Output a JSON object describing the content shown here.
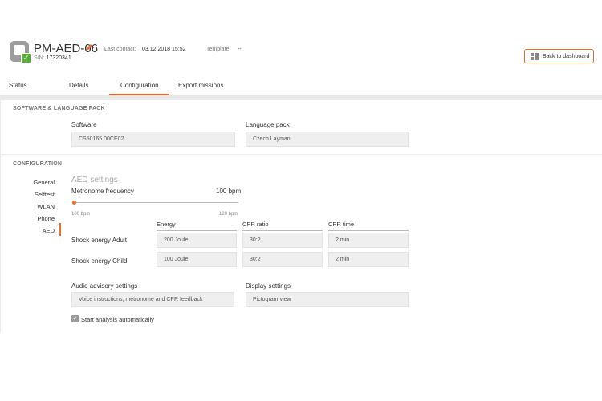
{
  "header": {
    "device_name": "PM-AED-06",
    "sn_label": "S/N:",
    "sn_value": "17320341",
    "last_contact_label": "Last contact:",
    "last_contact_value": "03.12.2018 15:52",
    "template_label": "Template:",
    "template_value": "--",
    "back_button_label": "Back to dashboard",
    "status_icon": "check-icon",
    "accent_color": "#ec6b2d",
    "status_color": "#5aae3a"
  },
  "tabs": [
    {
      "label": "Status"
    },
    {
      "label": "Details"
    },
    {
      "label": "Configuration",
      "active": true
    },
    {
      "label": "Export missions"
    }
  ],
  "software_section": {
    "title": "SOFTWARE & LANGUAGE PACK",
    "software_label": "Software",
    "software_value": "CS50165 00CE02",
    "language_label": "Language pack",
    "language_value": "Czech Layman"
  },
  "configuration_section": {
    "title": "CONFIGURATION",
    "nav": [
      {
        "label": "General"
      },
      {
        "label": "Selftest"
      },
      {
        "label": "WLAN"
      },
      {
        "label": "Phone"
      },
      {
        "label": "AED",
        "active": true
      }
    ],
    "aed_title": "AED settings",
    "metronome_label": "Metronome frequency",
    "metronome_value": "100 bpm",
    "slider_min_label": "100 bpm",
    "slider_max_label": "120 bpm",
    "slider_fraction": 0.0,
    "columns": [
      "Energy",
      "CPR ratio",
      "CPR time"
    ],
    "rows": [
      {
        "label": "Shock energy Adult",
        "energy": "200 Joule",
        "cpr_ratio": "30:2",
        "cpr_time": "2 min"
      },
      {
        "label": "Shock energy Child",
        "energy": "100 Joule",
        "cpr_ratio": "30:2",
        "cpr_time": "2 min"
      }
    ],
    "audio_label": "Audio advisory settings",
    "audio_value": "Voice instructions, metronome and CPR feedback",
    "display_label": "Display settings",
    "display_value": "Pictogram view",
    "auto_analysis_label": "Start analysis automatically",
    "auto_analysis_checked": true
  }
}
